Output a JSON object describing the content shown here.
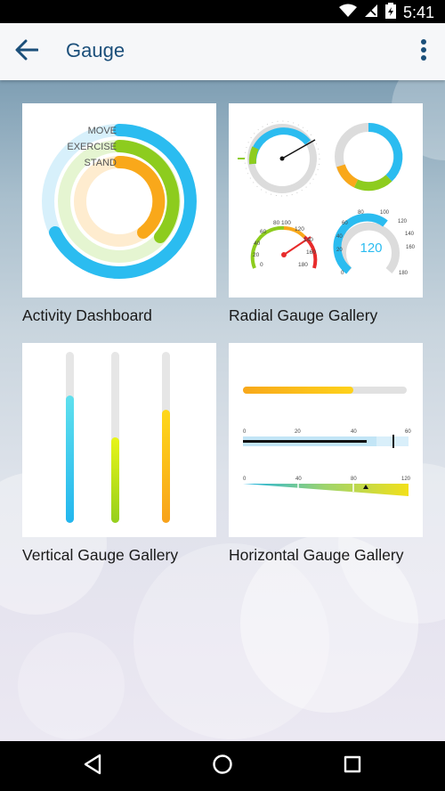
{
  "status_bar": {
    "time": "5:41"
  },
  "app_bar": {
    "title": "Gauge"
  },
  "tiles": [
    {
      "label": "Activity Dashboard",
      "rings": [
        "MOVE",
        "EXERCISE",
        "STAND"
      ]
    },
    {
      "label": "Radial Gauge Gallery",
      "gauge_ticks": [
        "80",
        "100",
        "120",
        "60",
        "140",
        "40",
        "160",
        "20",
        "180",
        "0"
      ],
      "gauge_value": "120",
      "gauge_scale": [
        "80",
        "100",
        "120",
        "60",
        "140",
        "40",
        "160",
        "20",
        "180",
        "0"
      ]
    },
    {
      "label": "Vertical Gauge Gallery"
    },
    {
      "label": "Horizontal Gauge Gallery",
      "bullet_ticks": [
        "0",
        "20",
        "40",
        "60"
      ],
      "linear_ticks": [
        "0",
        "40",
        "80",
        "120"
      ]
    }
  ],
  "colors": {
    "primary_text": "#1b4f7a",
    "cyan": "#2bbcf0",
    "green": "#8dcc1e",
    "orange": "#f9a81a"
  }
}
